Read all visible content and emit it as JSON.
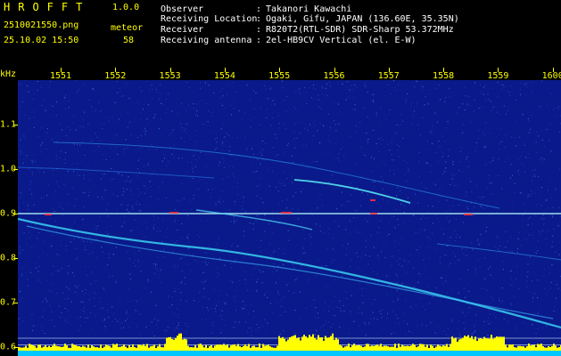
{
  "header": {
    "brand": "HROFFT",
    "version": "1.0.0",
    "filename": "2510021550.png",
    "datetime": "25.10.02 15:50",
    "meteor_label": "meteor",
    "meteor_count": "58",
    "info": [
      {
        "key": "Observer",
        "sep": ":",
        "value": "Takanori Kawachi"
      },
      {
        "key": "Receiving Location",
        "sep": ":",
        "value": "Ogaki, Gifu, JAPAN (136.60E, 35.35N)"
      },
      {
        "key": "Receiver",
        "sep": ":",
        "value": "R820T2(RTL-SDR) SDR-Sharp 53.372MHz"
      },
      {
        "key": "Receiving antenna",
        "sep": ":",
        "value": "2el-HB9CV Vertical (el. E-W)"
      }
    ]
  },
  "chart_data": {
    "type": "heatmap",
    "x_ticks": [
      "1551",
      "1552",
      "1553",
      "1554",
      "1555",
      "1556",
      "1557",
      "1558",
      "1559",
      "1600"
    ],
    "y_unit": "kHz",
    "y_ticks": [
      "1.1",
      "1.0",
      "0.9",
      "0.8",
      "0.7",
      "0.6"
    ],
    "y_values": [
      1.1,
      1.0,
      0.9,
      0.8,
      0.7,
      0.6
    ],
    "ylim": [
      0.58,
      1.2
    ],
    "xlim": [
      1550.5,
      1560.0
    ],
    "carrier_khz": 0.9,
    "colors": {
      "background": "#0a1a8a",
      "signal": "#00ffff",
      "strong": "#ff3040",
      "bar": "#ffff00",
      "bar_base": "#00c8ff"
    }
  }
}
